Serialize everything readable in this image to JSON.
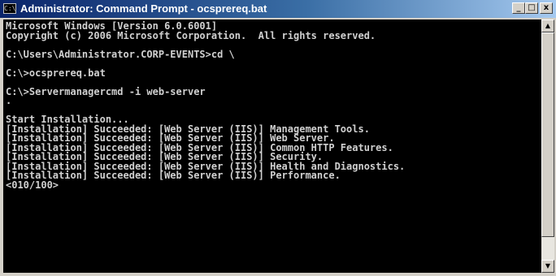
{
  "window": {
    "title": "Administrator: Command Prompt - ocsprereq.bat",
    "icon": "cmd-icon",
    "controls": {
      "minimize": "_",
      "maximize": "□",
      "close": "x"
    }
  },
  "console": {
    "lines": [
      "Microsoft Windows [Version 6.0.6001]",
      "Copyright (c) 2006 Microsoft Corporation.  All rights reserved.",
      "",
      "C:\\Users\\Administrator.CORP-EVENTS>cd \\",
      "",
      "C:\\>ocsprereq.bat",
      "",
      "C:\\>Servermanagercmd -i web-server",
      ".",
      "",
      "Start Installation...",
      "[Installation] Succeeded: [Web Server (IIS)] Management Tools.",
      "[Installation] Succeeded: [Web Server (IIS)] Web Server.",
      "[Installation] Succeeded: [Web Server (IIS)] Common HTTP Features.",
      "[Installation] Succeeded: [Web Server (IIS)] Security.",
      "[Installation] Succeeded: [Web Server (IIS)] Health and Diagnostics.",
      "[Installation] Succeeded: [Web Server (IIS)] Performance.",
      "<010/100>"
    ]
  },
  "scrollbar": {
    "up_arrow": "▲",
    "down_arrow": "▼"
  },
  "colors": {
    "console_bg": "#000000",
    "console_text": "#d0d0d0",
    "titlebar": "#0a246a"
  }
}
